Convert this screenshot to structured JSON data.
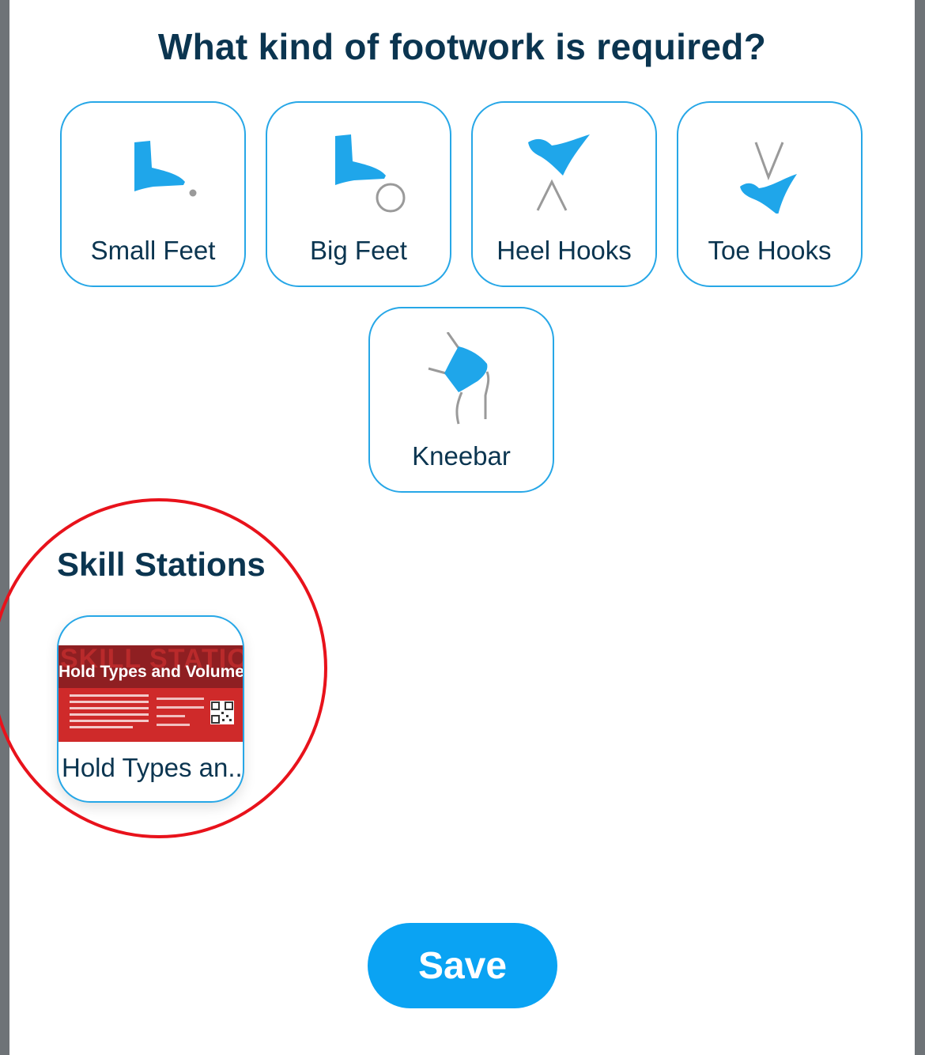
{
  "header": {
    "title": "What kind of footwork is required?"
  },
  "footwork_options": [
    {
      "label": "Small Feet",
      "icon": "small-feet-icon"
    },
    {
      "label": "Big Feet",
      "icon": "big-feet-icon"
    },
    {
      "label": "Heel Hooks",
      "icon": "heel-hook-icon"
    },
    {
      "label": "Toe Hooks",
      "icon": "toe-hook-icon"
    },
    {
      "label": "Kneebar",
      "icon": "kneebar-icon"
    }
  ],
  "skill_stations": {
    "title": "Skill Stations",
    "items": [
      {
        "label": "Hold Types an...",
        "thumbnail": {
          "watermark": "SKILL STATION",
          "heading": "Hold Types and Volumes"
        }
      }
    ]
  },
  "actions": {
    "save_label": "Save"
  },
  "colors": {
    "accent": "#27a7e7",
    "icon_fill": "#1fa6ea",
    "text": "#0b3550",
    "button": "#0aa3f3",
    "highlight": "#e8121b"
  }
}
